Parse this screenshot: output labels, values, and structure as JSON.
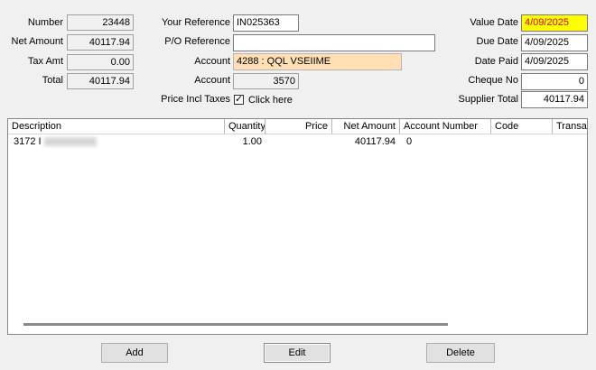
{
  "left_fields": {
    "number_label": "Number",
    "number_value": "23448",
    "net_amount_label": "Net Amount",
    "net_amount_value": "40117.94",
    "tax_amt_label": "Tax Amt",
    "tax_amt_value": "0.00",
    "total_label": "Total",
    "total_value": "40117.94"
  },
  "middle_fields": {
    "your_reference_label": "Your Reference",
    "your_reference_value": "IN025363",
    "po_reference_label": "P/O Reference",
    "po_reference_value": "",
    "account_label": "Account",
    "account_value": "4288 : QQL VSEIIME",
    "account2_label": "Account",
    "account2_value": "3570",
    "price_incl_taxes_label": "Price Incl Taxes",
    "price_incl_taxes_checked": true,
    "click_here_label": "Click here",
    "check_mark": "✓"
  },
  "right_fields": {
    "value_date_label": "Value Date",
    "value_date_value": "4/09/2025",
    "due_date_label": "Due Date",
    "due_date_value": "4/09/2025",
    "date_paid_label": "Date Paid",
    "date_paid_value": "4/09/2025",
    "cheque_no_label": "Cheque No",
    "cheque_no_value": "0",
    "supplier_total_label": "Supplier Total",
    "supplier_total_value": "40117.94"
  },
  "grid": {
    "columns": [
      "Description",
      "Quantity",
      "Price",
      "Net Amount",
      "Account Number",
      "Code",
      "Transa"
    ],
    "rows": [
      {
        "description": "3172 I",
        "quantity": "1.00",
        "price": "",
        "net_amount": "40117.94",
        "account_number": "0",
        "code": "",
        "transa": ""
      }
    ]
  },
  "buttons": {
    "add": "Add",
    "edit": "Edit",
    "delete": "Delete"
  },
  "colors": {
    "value_date_bg": "#ffff00",
    "value_date_text": "#e00000",
    "account_bg": "#ffdfb3"
  }
}
